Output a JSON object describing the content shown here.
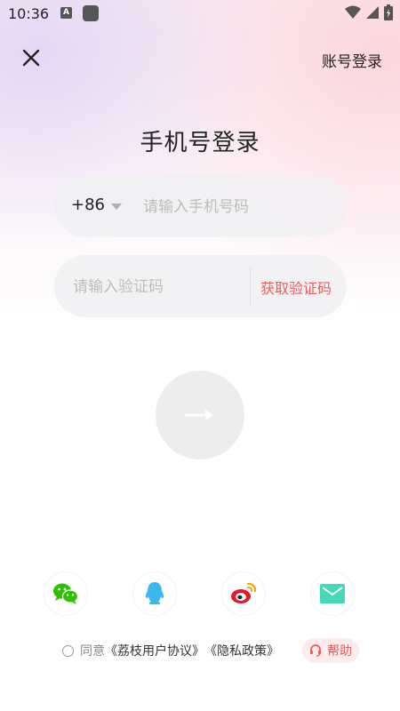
{
  "status_bar": {
    "time": "10:36",
    "notification_letter": "A"
  },
  "header": {
    "close_icon": "close-icon",
    "account_login_label": "账号登录"
  },
  "main": {
    "title": "手机号登录",
    "phone": {
      "country_code": "+86",
      "placeholder": "请输入手机号码",
      "value": ""
    },
    "code": {
      "placeholder": "请输入验证码",
      "value": "",
      "get_code_label": "获取验证码"
    },
    "submit_icon": "arrow-right-icon"
  },
  "social_login": [
    {
      "name": "wechat",
      "icon": "wechat-icon",
      "color": "#2dc100"
    },
    {
      "name": "qq",
      "icon": "qq-icon",
      "color": "#3cb7f0"
    },
    {
      "name": "weibo",
      "icon": "weibo-icon",
      "color": "#e6162d"
    },
    {
      "name": "email",
      "icon": "email-icon",
      "color": "#45d8b9"
    }
  ],
  "footer": {
    "agree_prefix": "同意",
    "user_agreement": "《荔枝用户协议》",
    "privacy_policy": "《隐私政策》",
    "help_label": "帮助"
  },
  "colors": {
    "accent": "#f25a5a",
    "placeholder": "#bdbdbd",
    "field_bg": "#f0f0f2"
  }
}
